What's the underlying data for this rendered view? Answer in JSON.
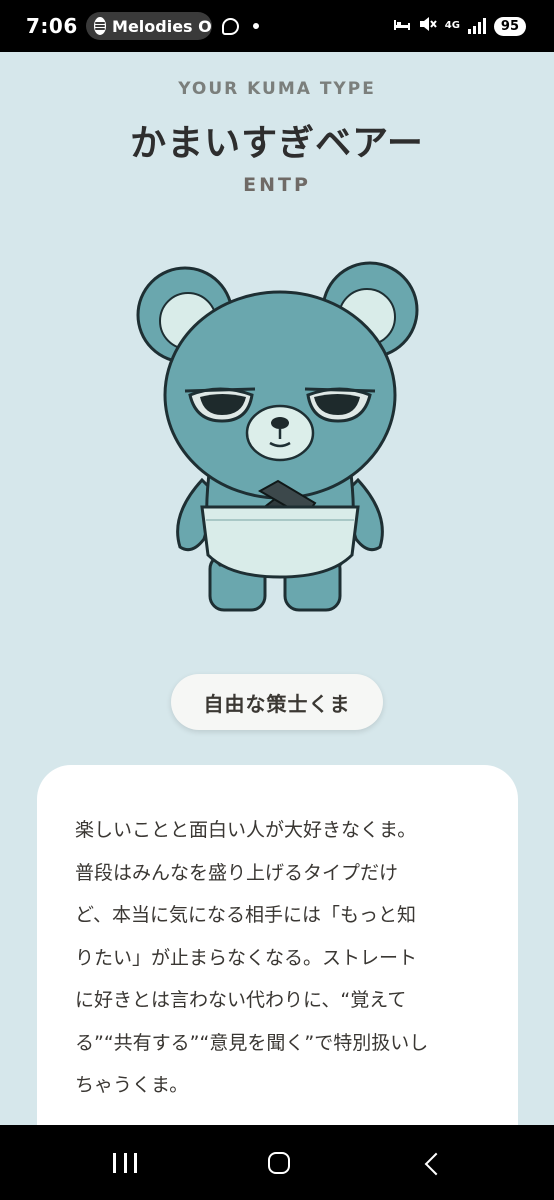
{
  "status_bar": {
    "time": "7:06",
    "now_playing": "Melodies O",
    "battery": "95",
    "network": "4G"
  },
  "header": {
    "kicker": "YOUR KUMA TYPE",
    "title": "かまいすぎベアー",
    "mbti": "ENTP"
  },
  "tag": {
    "label": "自由な策士くま"
  },
  "description": {
    "text": "楽しいことと面白い人が大好きなくま。\n普段はみんなを盛り上げるタイプだけ\nど、本当に気になる相手には「もっと知\nりたい」が止まらなくなる。ストレート\nに好きとは言わない代わりに、“覚えて\nる”“共有する”“意見を聞く”で特別扱いし\nちゃうくま。"
  },
  "colors": {
    "background": "#d6e7eb",
    "bear_fill": "#6aa7ae",
    "bear_inner": "#d9ece9",
    "card": "#ffffff"
  },
  "icons": {
    "nav": [
      "recent-apps-icon",
      "home-icon",
      "back-icon"
    ]
  }
}
